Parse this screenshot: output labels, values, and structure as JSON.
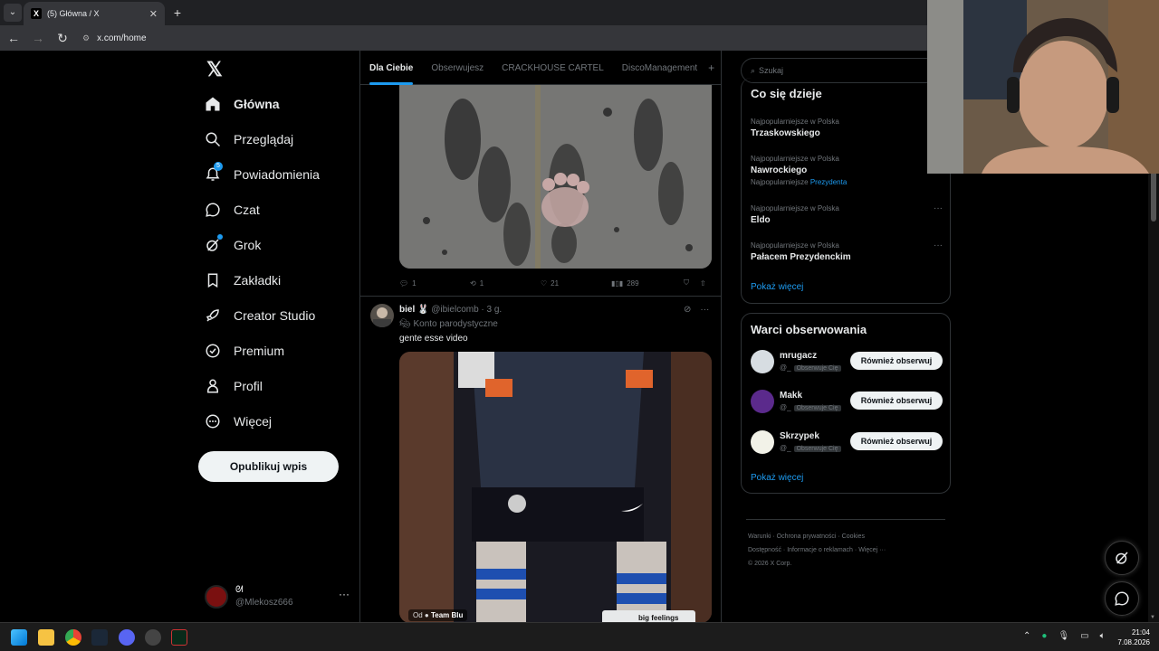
{
  "browser": {
    "tab_title": "(5) Główna / X",
    "tab_favicon": "X",
    "url": "x.com/home"
  },
  "nav": {
    "logo": "𝕏",
    "items": [
      {
        "label": "Główna",
        "icon": "home-icon"
      },
      {
        "label": "Przeglądaj",
        "icon": "search-icon"
      },
      {
        "label": "Powiadomienia",
        "icon": "bell-icon",
        "badge": "5"
      },
      {
        "label": "Czat",
        "icon": "chat-icon"
      },
      {
        "label": "Grok",
        "icon": "grok-icon"
      },
      {
        "label": "Zakładki",
        "icon": "bookmark-icon"
      },
      {
        "label": "Creator Studio",
        "icon": "rocket-icon"
      },
      {
        "label": "Premium",
        "icon": "verified-icon"
      },
      {
        "label": "Profil",
        "icon": "person-icon"
      },
      {
        "label": "Więcej",
        "icon": "more-circle-icon"
      }
    ],
    "post_button": "Opublikuj wpis",
    "account": {
      "name": "ᘛ",
      "handle": "@Mlekosz666",
      "more": "···"
    }
  },
  "feed": {
    "tabs": [
      "Dla Ciebie",
      "Obserwujesz",
      "CRACKHOUSE CARTEL",
      "DiscoManagement"
    ],
    "tab_plus": "+",
    "tweet1_actions": {
      "replies": "1",
      "reposts": "1",
      "likes": "21",
      "views": "289"
    },
    "tweet2": {
      "name": "biel 🐰",
      "handle": "@ibielcomb · 3 g.",
      "parody": "Konto parodystyczne",
      "text": "gente esse video",
      "video_label_prefix": "Od",
      "video_label": "Team Blu",
      "pip_text": "big feelings"
    }
  },
  "sidebar": {
    "search_placeholder": "Szukaj",
    "trends_title": "Co się dzieje",
    "trends": [
      {
        "context": "Najpopularniejsze w Polska",
        "name": "Trzaskowskiego"
      },
      {
        "context": "Najpopularniejsze w Polska",
        "name": "Nawrockiego",
        "extra_prefix": "Najpopularniejsze",
        "extra_link": "Prezydenta"
      },
      {
        "context": "Najpopularniejsze w Polska",
        "name": "Eldo"
      },
      {
        "context": "Najpopularniejsze w Polska",
        "name": "Pałacem Prezydenckim"
      }
    ],
    "show_more": "Pokaż więcej",
    "who_title": "Warci obserwowania",
    "who": [
      {
        "name": "mrugacz",
        "handle": "@_",
        "tag": "Obserwuje Cię",
        "button": "Również obserwuj",
        "color": "#d7dde2"
      },
      {
        "name": "Makk",
        "handle": "@_",
        "tag": "Obserwuje Cię",
        "button": "Również obserwuj",
        "color": "#5b2a8c"
      },
      {
        "name": "Skrzypek",
        "handle": "@_",
        "tag": "Obserwuje Cię",
        "button": "Również obserwuj",
        "color": "#f2f2e8"
      }
    ],
    "footer": [
      "Warunki",
      "Ochrona prywatności",
      "Cookies",
      "Dostępność",
      "Informacje o reklamach",
      "Więcej ···",
      "© 2026 X Corp."
    ]
  },
  "taskbar": {
    "time": "21:04",
    "date": "7.08.2026"
  },
  "colors": {
    "accent": "#1d9bf0",
    "background": "#000000",
    "border": "#2f3336"
  }
}
